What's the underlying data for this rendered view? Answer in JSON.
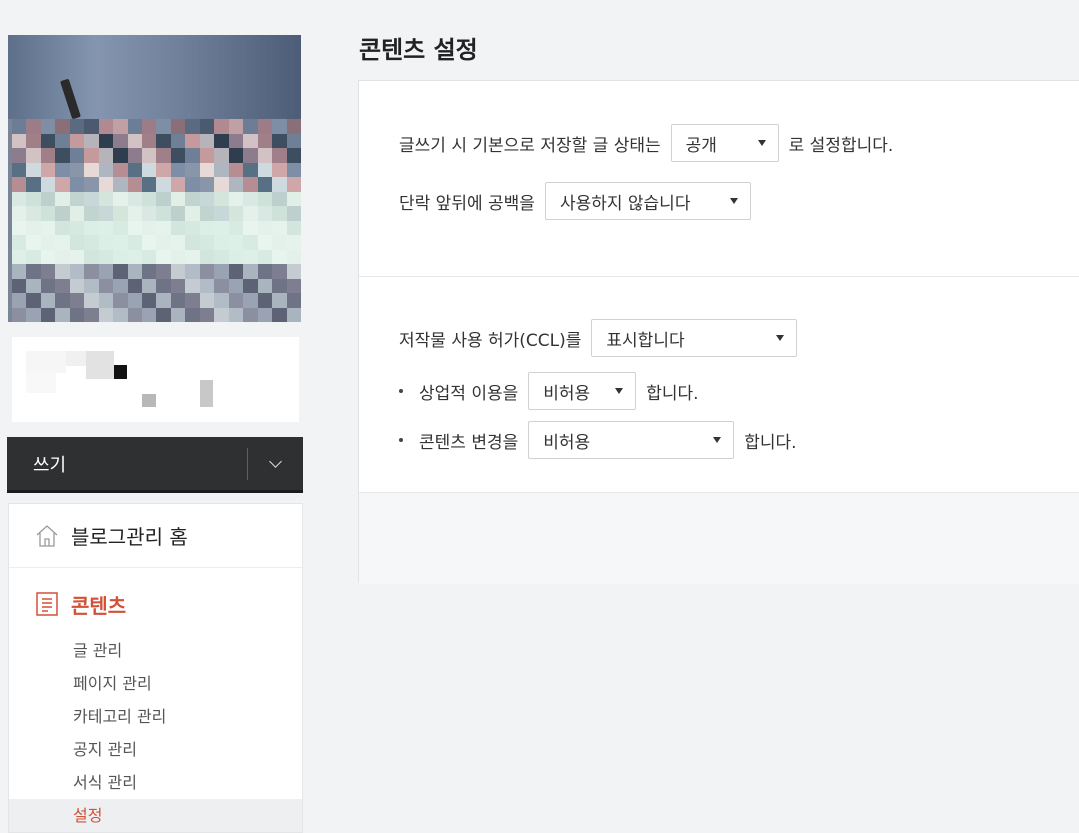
{
  "sidebar": {
    "write_label": "쓰기",
    "menu": {
      "home_label": "블로그관리 홈",
      "content_label": "콘텐츠",
      "items": [
        {
          "label": "글 관리"
        },
        {
          "label": "페이지 관리"
        },
        {
          "label": "카테고리 관리"
        },
        {
          "label": "공지 관리"
        },
        {
          "label": "서식 관리"
        },
        {
          "label": "설정",
          "active": true
        }
      ]
    }
  },
  "main": {
    "title": "콘텐츠 설정",
    "section1": {
      "row1": {
        "prefix": "글쓰기 시 기본으로 저장할 글 상태는",
        "select_value": "공개",
        "suffix": "로 설정합니다."
      },
      "row2": {
        "prefix": "단락 앞뒤에 공백을",
        "select_value": "사용하지 않습니다"
      }
    },
    "section2": {
      "row1": {
        "prefix": "저작물 사용 허가(CCL)를",
        "select_value": "표시합니다"
      },
      "row2": {
        "prefix": "상업적 이용을",
        "select_value": "비허용",
        "suffix": "합니다."
      },
      "row3": {
        "prefix": "콘텐츠 변경을",
        "select_value": "비허용",
        "suffix": "합니다."
      }
    }
  },
  "colors": {
    "accent": "#d25137",
    "write_bar": "#2f3031",
    "page_bg": "#f2f3f5"
  },
  "icons": {
    "home": "home-icon",
    "content": "document-icon",
    "dropdown": "caret-down-icon",
    "write_toggle": "chevron-down-icon"
  }
}
